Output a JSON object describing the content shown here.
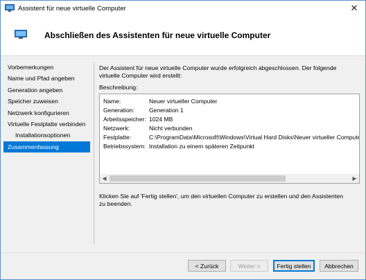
{
  "window": {
    "title": "Assistent für neue virtuelle Computer",
    "close_glyph": "✕"
  },
  "header": {
    "title": "Abschließen des Assistenten für neue virtuelle Computer"
  },
  "nav": {
    "items": [
      {
        "label": "Vorbemerkungen"
      },
      {
        "label": "Name und Pfad angeben"
      },
      {
        "label": "Generation angeben"
      },
      {
        "label": "Speicher zuweisen"
      },
      {
        "label": "Netzwerk konfigurieren"
      },
      {
        "label": "Virtuelle Festplatte verbinden"
      },
      {
        "label": "Installationsoptionen"
      },
      {
        "label": "Zusammenfassung"
      }
    ],
    "active_index": 7
  },
  "main": {
    "intro": "Der Assistent für neue virtuelle Computer wurde erfolgreich abgeschlossen. Der folgende virtuelle Computer wird erstellt:",
    "description_label": "Beschreibung:",
    "description": [
      {
        "key": "Name:",
        "value": "Neuer virtueller Computer"
      },
      {
        "key": "Generation:",
        "value": "Generation 1"
      },
      {
        "key": "Arbeitsspeicher:",
        "value": "1024 MB"
      },
      {
        "key": "Netzwerk:",
        "value": "Nicht verbunden"
      },
      {
        "key": "Festplatte:",
        "value": "C:\\ProgramData\\Microsoft\\Windows\\Virtual Hard Disks\\Neuer virtueller Computer.vhdx"
      },
      {
        "key": "Betriebssystem:",
        "value": "Installation zu einem späteren Zeitpunkt"
      }
    ],
    "finish_text": "Klicken Sie auf 'Fertig stellen', um den virtuellen Computer zu erstellen und den Assistenten zu beenden."
  },
  "buttons": {
    "back": "< Zurück",
    "next": "Weiter >",
    "finish": "Fertig stellen",
    "cancel": "Abbrechen"
  },
  "colors": {
    "accent": "#0078d7",
    "content_bg": "#f0f0f0"
  }
}
